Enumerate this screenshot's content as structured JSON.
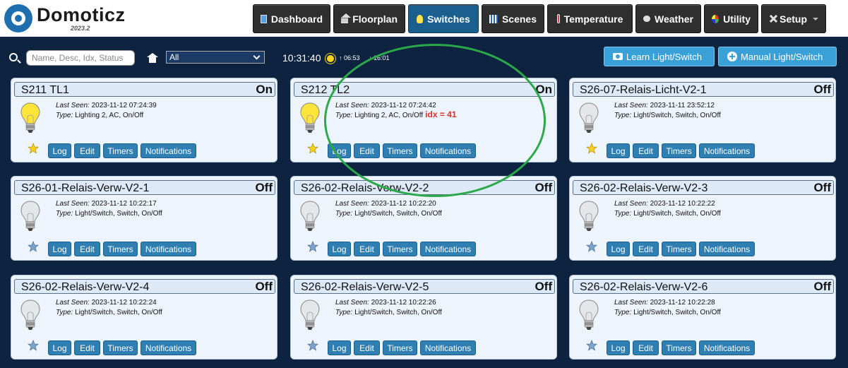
{
  "app": {
    "name": "Domoticz",
    "version": "2023.2"
  },
  "nav": [
    {
      "label": "Dashboard",
      "icon": "dashboard-icon",
      "active": false
    },
    {
      "label": "Floorplan",
      "icon": "floorplan-icon",
      "active": false
    },
    {
      "label": "Switches",
      "icon": "lightbulb-icon",
      "active": true
    },
    {
      "label": "Scenes",
      "icon": "scenes-icon",
      "active": false
    },
    {
      "label": "Temperature",
      "icon": "thermometer-icon",
      "active": false
    },
    {
      "label": "Weather",
      "icon": "weather-icon",
      "active": false
    },
    {
      "label": "Utility",
      "icon": "utility-icon",
      "active": false
    },
    {
      "label": "Setup",
      "icon": "setup-icon",
      "active": false
    }
  ],
  "toolbar": {
    "search_placeholder": "Name, Desc, Idx, Status",
    "room_selected": "All",
    "time": "10:31:40",
    "sunrise": "06:53",
    "sunset": "16:01",
    "learn_label": "Learn Light/Switch",
    "manual_label": "Manual Light/Switch"
  },
  "card_labels": {
    "last_seen": "Last Seen:",
    "type": "Type:",
    "log": "Log",
    "edit": "Edit",
    "timers": "Timers",
    "notifications": "Notifications"
  },
  "devices": [
    {
      "name": "S211 TL1",
      "status": "On",
      "last_seen": "2023-11-12 07:24:39",
      "type": "Lighting 2, AC, On/Off",
      "favorite": true,
      "note": ""
    },
    {
      "name": "S212 TL2",
      "status": "On",
      "last_seen": "2023-11-12 07:24:42",
      "type": "Lighting 2, AC, On/Off",
      "favorite": true,
      "note": "idx = 41"
    },
    {
      "name": "S26-07-Relais-Licht-V2-1",
      "status": "Off",
      "last_seen": "2023-11-11 23:52:12",
      "type": "Light/Switch, Switch, On/Off",
      "favorite": true,
      "note": ""
    },
    {
      "name": "S26-01-Relais-Verw-V2-1",
      "status": "Off",
      "last_seen": "2023-11-12 10:22:17",
      "type": "Light/Switch, Switch, On/Off",
      "favorite": false,
      "note": ""
    },
    {
      "name": "S26-02-Relais-Verw-V2-2",
      "status": "Off",
      "last_seen": "2023-11-12 10:22:20",
      "type": "Light/Switch, Switch, On/Off",
      "favorite": false,
      "note": ""
    },
    {
      "name": "S26-02-Relais-Verw-V2-3",
      "status": "Off",
      "last_seen": "2023-11-12 10:22:22",
      "type": "Light/Switch, Switch, On/Off",
      "favorite": false,
      "note": ""
    },
    {
      "name": "S26-02-Relais-Verw-V2-4",
      "status": "Off",
      "last_seen": "2023-11-12 10:22:24",
      "type": "Light/Switch, Switch, On/Off",
      "favorite": false,
      "note": ""
    },
    {
      "name": "S26-02-Relais-Verw-V2-5",
      "status": "Off",
      "last_seen": "2023-11-12 10:22:26",
      "type": "Light/Switch, Switch, On/Off",
      "favorite": false,
      "note": ""
    },
    {
      "name": "S26-02-Relais-Verw-V2-6",
      "status": "Off",
      "last_seen": "2023-11-12 10:22:28",
      "type": "Light/Switch, Switch, On/Off",
      "favorite": false,
      "note": ""
    }
  ],
  "colors": {
    "background": "#0d2340",
    "accent": "#1b5f8e",
    "button": "#2f7fb3",
    "highlight": "#2aa84a",
    "note": "#e12a2a"
  }
}
